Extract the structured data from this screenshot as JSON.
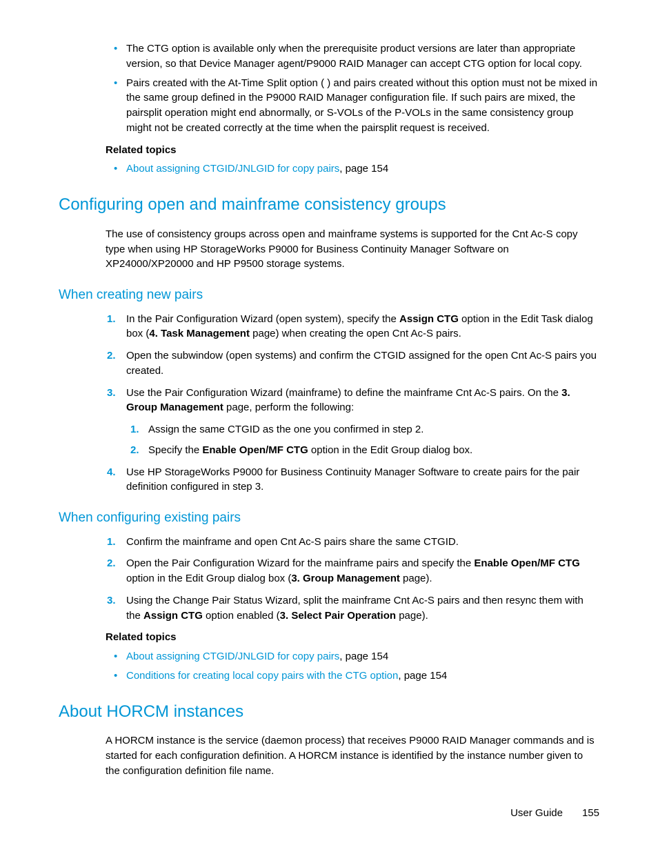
{
  "top_bullets": [
    "The CTG option is available only when the prerequisite product versions are later than appropriate version, so that Device Manager agent/P9000 RAID Manager can accept CTG option for local copy.",
    "Pairs created with the At-Time Split option (            ) and pairs created without this option must not be mixed in the same group defined in the P9000 RAID Manager configuration file. If such pairs are mixed, the pairsplit operation might end abnormally, or S-VOLs of the P-VOLs in the same consistency group might not be created correctly at the time when the pairsplit request is received."
  ],
  "related_heading": "Related topics",
  "related1_link": "About assigning CTGID/JNLGID for copy pairs",
  "related1_tail": ", page 154",
  "h2_configuring": "Configuring open and mainframe consistency groups",
  "p_configuring": "The use of consistency groups across open and mainframe systems is supported for the Cnt Ac-S copy type when using HP StorageWorks P9000 for Business Continuity Manager Software on XP24000/XP20000 and HP P9500 storage systems.",
  "h3_creating": "When creating new pairs",
  "create1a": "In the Pair Configuration Wizard (open system), specify the ",
  "create1b_bold": "Assign CTG",
  "create1c": " option in the Edit Task dialog box (",
  "create1d_bold": "4. Task Management",
  "create1e": " page) when creating the open Cnt Ac-S pairs.",
  "create2a": "Open the                              subwindow (open systems) and confirm the CTGID assigned for the open Cnt Ac-S pairs you created.",
  "create3a": "Use the Pair Configuration Wizard (mainframe) to define the mainframe Cnt Ac-S pairs. On the ",
  "create3b_bold": "3. Group Management",
  "create3c": " page, perform the following:",
  "create3s1": "Assign the same CTGID as the one you confirmed in step 2.",
  "create3s2a": "Specify the ",
  "create3s2b_bold": "Enable Open/MF CTG",
  "create3s2c": " option in the Edit Group dialog box.",
  "create4": "Use HP StorageWorks P9000 for Business Continuity Manager Software to create pairs for the pair definition configured in step 3.",
  "h3_existing": "When configuring existing pairs",
  "exist1": "Confirm the mainframe and open Cnt Ac-S pairs share the same CTGID.",
  "exist2a": "Open the Pair Configuration Wizard for the mainframe pairs and specify the ",
  "exist2b_bold": "Enable Open/MF CTG",
  "exist2c": " option in the Edit Group dialog box (",
  "exist2d_bold": "3. Group Management",
  "exist2e": " page).",
  "exist3a": "Using the Change Pair Status Wizard, split the mainframe Cnt Ac-S pairs and then resync them with the ",
  "exist3b_bold": "Assign CTG",
  "exist3c": " option enabled (",
  "exist3d_bold": "3. Select Pair Operation",
  "exist3e": " page).",
  "related2_l1_link": "About assigning CTGID/JNLGID for copy pairs",
  "related2_l1_tail": ", page 154",
  "related2_l2_link": "Conditions for creating local copy pairs with the CTG option",
  "related2_l2_tail": ", page 154",
  "h2_horcm": "About HORCM instances",
  "p_horcm": "A HORCM instance is the service (daemon process) that receives P9000 RAID Manager commands and is started for each configuration definition. A HORCM instance is identified by the instance number given to the configuration definition file name.",
  "footer_label": "User Guide",
  "footer_page": "155"
}
